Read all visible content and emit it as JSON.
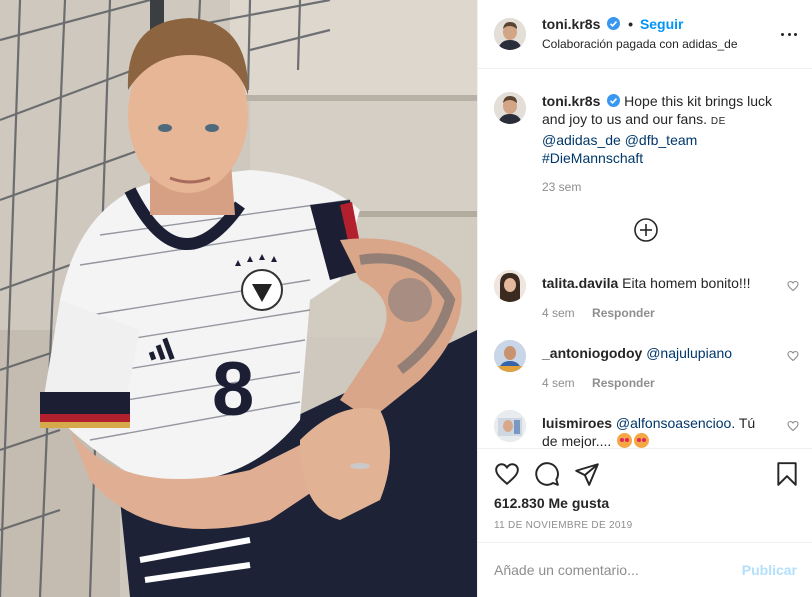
{
  "photo": {
    "alt_subject": "football-player-photo",
    "jersey_number": "8"
  },
  "header": {
    "username": "toni.kr8s",
    "separator": "•",
    "follow_label": "Seguir",
    "partnership_prefix": "Colaboración pagada con",
    "partner": "adidas_de",
    "more_icon": "more-options-icon"
  },
  "caption": {
    "username": "toni.kr8s",
    "text": "Hope this kit brings luck and joy to us and our fans.",
    "small_caps": "DE",
    "mention_1": "@adidas_de",
    "mention_2": "@dfb_team",
    "hashtag": "#DieMannschaft",
    "time": "23 sem"
  },
  "load_more_icon": "circle-plus-icon",
  "comments": [
    {
      "username": "talita.davila",
      "text": "Eita homem bonito!!!",
      "time": "4 sem",
      "reply_label": "Responder"
    },
    {
      "username": "_antoniogodoy",
      "mention": "@najulupiano",
      "text": "",
      "time": "4 sem",
      "reply_label": "Responder"
    },
    {
      "username": "luismiroes",
      "mention": "@alfonsoasencioo.",
      "text": "Tú de mejor....",
      "time": "",
      "reply_label": ""
    }
  ],
  "actions": {
    "like_icon": "heart-icon",
    "comment_icon": "comment-icon",
    "share_icon": "paper-plane-icon",
    "save_icon": "bookmark-icon",
    "likes": "612.830 Me gusta",
    "date": "11 DE NOVIEMBRE DE 2019"
  },
  "add_comment": {
    "placeholder": "Añade un comentario...",
    "publish_label": "Publicar"
  },
  "colors": {
    "link_blue": "#0095f6",
    "text": "#262626",
    "muted": "#8e8e8e",
    "mention": "#00376b",
    "publish_disabled": "#b2dffc"
  }
}
